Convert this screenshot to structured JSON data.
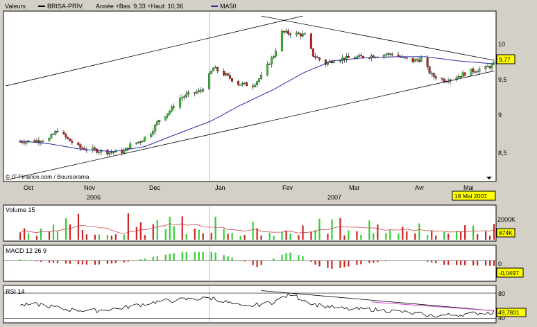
{
  "header": {
    "valeurs_label": "Valeurs",
    "ticker": "BRISA-PRIV.",
    "year_range": "Année +Bas: 9,33 +Haut: 10,36",
    "ma_label": "MA50"
  },
  "source_note": "© IT-Finance.com / Boursorama",
  "x_axis": {
    "months": [
      "Oct",
      "Nov",
      "Dec",
      "Jan",
      "Fev",
      "Mar",
      "Avr",
      "Mai"
    ],
    "years": [
      "2006",
      "2007"
    ],
    "date_badge": "18 Mai 2007"
  },
  "colors": {
    "up": "#33cc33",
    "down": "#cc2222",
    "ma": "#2a2aa0",
    "badge": "#ffff00",
    "rsi_trend": "#cc44cc",
    "panel_bg": "#ffffff"
  },
  "price_panel": {
    "y_ticks": [
      "10",
      "9,5",
      "9",
      "8,5"
    ],
    "last_value": "9,77"
  },
  "volume_panel": {
    "label": "Volume 15",
    "y_tick": "2000K",
    "last_value": "874K"
  },
  "macd_panel": {
    "label": "MACD 12 26 9",
    "y_tick": "0",
    "last_value": "-0,0497"
  },
  "rsi_panel": {
    "label": "RSI 14",
    "y_ticks": [
      "80",
      "40"
    ],
    "last_value": "49,7831"
  },
  "chart_data": {
    "type": "candlestick",
    "title": "BRISA-PRIV.",
    "x_range": [
      "2006-09-25",
      "2007-05-18"
    ],
    "price": {
      "ylim": [
        8.15,
        10.5
      ],
      "last": 9.77,
      "year_low": 9.33,
      "year_high": 10.36,
      "close_path": [
        [
          "2006-10-02",
          8.69
        ],
        [
          "2006-10-09",
          8.7
        ],
        [
          "2006-10-16",
          8.73
        ],
        [
          "2006-10-20",
          8.85
        ],
        [
          "2006-10-25",
          8.72
        ],
        [
          "2006-10-31",
          8.6
        ],
        [
          "2006-11-07",
          8.57
        ],
        [
          "2006-11-14",
          8.54
        ],
        [
          "2006-11-21",
          8.55
        ],
        [
          "2006-11-24",
          8.64
        ],
        [
          "2006-11-29",
          8.7
        ],
        [
          "2006-12-04",
          8.82
        ],
        [
          "2006-12-08",
          9.0
        ],
        [
          "2006-12-13",
          9.12
        ],
        [
          "2006-12-18",
          9.3
        ],
        [
          "2006-12-22",
          9.35
        ],
        [
          "2006-12-28",
          9.4
        ],
        [
          "2007-01-03",
          9.72
        ],
        [
          "2007-01-09",
          9.62
        ],
        [
          "2007-01-15",
          9.5
        ],
        [
          "2007-01-22",
          9.48
        ],
        [
          "2007-01-26",
          9.6
        ],
        [
          "2007-02-01",
          9.9
        ],
        [
          "2007-02-05",
          10.22
        ],
        [
          "2007-02-12",
          10.2
        ],
        [
          "2007-02-16",
          10.18
        ],
        [
          "2007-02-20",
          9.9
        ],
        [
          "2007-02-26",
          9.78
        ],
        [
          "2007-03-02",
          9.84
        ],
        [
          "2007-03-09",
          9.86
        ],
        [
          "2007-03-16",
          9.88
        ],
        [
          "2007-03-23",
          9.9
        ],
        [
          "2007-03-30",
          9.92
        ],
        [
          "2007-04-04",
          9.86
        ],
        [
          "2007-04-09",
          9.82
        ],
        [
          "2007-04-13",
          9.85
        ],
        [
          "2007-04-18",
          9.62
        ],
        [
          "2007-04-24",
          9.55
        ],
        [
          "2007-04-30",
          9.6
        ],
        [
          "2007-05-07",
          9.68
        ],
        [
          "2007-05-14",
          9.72
        ],
        [
          "2007-05-18",
          9.77
        ]
      ],
      "ma50": [
        [
          "2006-10-02",
          8.7
        ],
        [
          "2006-10-16",
          8.66
        ],
        [
          "2006-11-01",
          8.58
        ],
        [
          "2006-11-16",
          8.55
        ],
        [
          "2006-12-01",
          8.62
        ],
        [
          "2006-12-15",
          8.78
        ],
        [
          "2007-01-02",
          8.98
        ],
        [
          "2007-01-16",
          9.2
        ],
        [
          "2007-02-01",
          9.42
        ],
        [
          "2007-02-15",
          9.65
        ],
        [
          "2007-03-01",
          9.82
        ],
        [
          "2007-03-15",
          9.86
        ],
        [
          "2007-04-01",
          9.88
        ],
        [
          "2007-04-15",
          9.88
        ],
        [
          "2007-05-01",
          9.82
        ],
        [
          "2007-05-18",
          9.78
        ]
      ],
      "trendlines": [
        {
          "from": [
            "2006-09-25",
            9.47
          ],
          "to": [
            "2007-02-15",
            10.45
          ]
        },
        {
          "from": [
            "2006-09-25",
            8.15
          ],
          "to": [
            "2007-05-18",
            9.68
          ]
        },
        {
          "from": [
            "2007-01-26",
            10.45
          ],
          "to": [
            "2007-05-18",
            9.83
          ]
        }
      ]
    },
    "volume": {
      "ylim": [
        0,
        2600000
      ],
      "last": 874000,
      "reference_tick": 2000000
    },
    "macd": {
      "ylim": [
        -0.18,
        0.13
      ],
      "last": -0.0497,
      "histogram_path": [
        [
          "2006-10-02",
          0.01
        ],
        [
          "2006-10-16",
          -0.02
        ],
        [
          "2006-11-06",
          -0.04
        ],
        [
          "2006-11-20",
          -0.02
        ],
        [
          "2006-12-04",
          0.03
        ],
        [
          "2006-12-18",
          0.08
        ],
        [
          "2007-01-03",
          0.08
        ],
        [
          "2007-01-17",
          0.0
        ],
        [
          "2007-01-24",
          -0.06
        ],
        [
          "2007-02-01",
          0.02
        ],
        [
          "2007-02-08",
          0.08
        ],
        [
          "2007-02-15",
          0.04
        ],
        [
          "2007-02-22",
          -0.05
        ],
        [
          "2007-03-02",
          -0.08
        ],
        [
          "2007-03-16",
          -0.03
        ],
        [
          "2007-03-30",
          0.0
        ],
        [
          "2007-04-13",
          0.0
        ],
        [
          "2007-04-24",
          -0.04
        ],
        [
          "2007-05-18",
          -0.0497
        ]
      ]
    },
    "rsi": {
      "ylim": [
        35,
        90
      ],
      "levels": [
        80,
        40
      ],
      "last": 49.7831,
      "path": [
        [
          "2006-09-27",
          60
        ],
        [
          "2006-10-12",
          62
        ],
        [
          "2006-10-24",
          54
        ],
        [
          "2006-11-07",
          52
        ],
        [
          "2006-11-21",
          57
        ],
        [
          "2006-12-06",
          66
        ],
        [
          "2006-12-20",
          70
        ],
        [
          "2007-01-03",
          72
        ],
        [
          "2007-01-17",
          58
        ],
        [
          "2007-01-31",
          65
        ],
        [
          "2007-02-09",
          78
        ],
        [
          "2007-02-21",
          62
        ],
        [
          "2007-03-07",
          55
        ],
        [
          "2007-03-21",
          54
        ],
        [
          "2007-04-04",
          50
        ],
        [
          "2007-04-18",
          44
        ],
        [
          "2007-05-02",
          46
        ],
        [
          "2007-05-18",
          49.78
        ]
      ],
      "trendline": {
        "from": [
          "2007-01-26",
          84
        ],
        "to": [
          "2007-05-18",
          52
        ]
      }
    }
  }
}
